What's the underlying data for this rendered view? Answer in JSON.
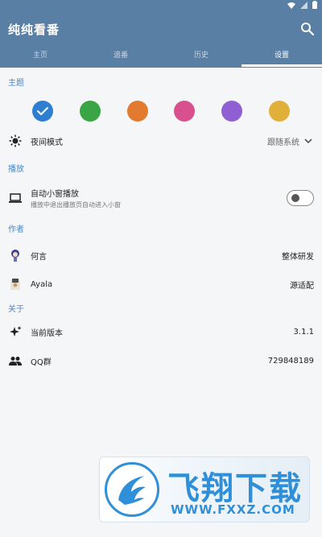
{
  "app": {
    "title": "纯纯看番"
  },
  "tabs": [
    {
      "label": "主页"
    },
    {
      "label": "追番"
    },
    {
      "label": "历史"
    },
    {
      "label": "设置"
    }
  ],
  "theme": {
    "section_title": "主题",
    "colors": [
      "#2f7fd0",
      "#3aa544",
      "#e27a2f",
      "#d9508f",
      "#8f5fd3",
      "#e0b03a"
    ],
    "selected_index": 0,
    "night_mode": {
      "label": "夜间模式",
      "value": "跟随系统"
    }
  },
  "playback": {
    "section_title": "播放",
    "auto_pip": {
      "label": "自动小窗播放",
      "desc": "播放中退出播放页自动进入小窗",
      "enabled": false
    }
  },
  "authors": {
    "section_title": "作者",
    "items": [
      {
        "name": "何言",
        "role": "整体研发"
      },
      {
        "name": "Ayala",
        "role": "源适配"
      }
    ]
  },
  "about": {
    "section_title": "关于",
    "version": {
      "label": "当前版本",
      "value": "3.1.1"
    },
    "qq": {
      "label": "QQ群",
      "value": "729848189"
    }
  },
  "watermark": {
    "text": "飞翔下载",
    "url": "WWW.FXXZ.COM"
  }
}
